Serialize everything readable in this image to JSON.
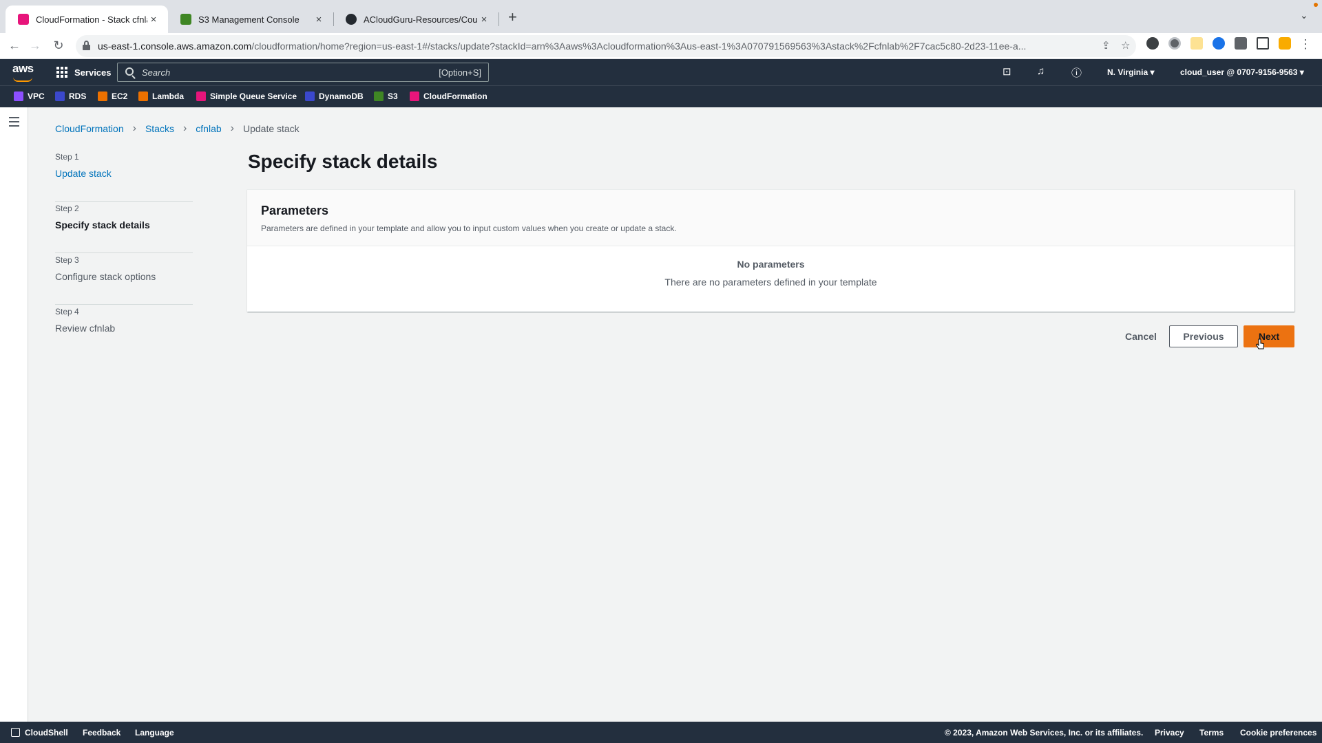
{
  "browser": {
    "tabs": [
      {
        "title": "CloudFormation - Stack cfnlab",
        "favicon_color": "#e7157b",
        "active": true
      },
      {
        "title": "S3 Management Console",
        "favicon_color": "#3f8624",
        "active": false
      },
      {
        "title": "ACloudGuru-Resources/Course",
        "favicon_color": "#24292f",
        "active": false
      }
    ],
    "close_glyph": "×",
    "new_tab_glyph": "+",
    "url_host": "us-east-1.console.aws.amazon.com",
    "url_path": "/cloudformation/home?region=us-east-1#/stacks/update?stackId=arn%3Aaws%3Acloudformation%3Aus-east-1%3A070791569563%3Astack%2Fcfnlab%2F7cac5c80-2d23-11ee-a..."
  },
  "aws": {
    "logo_text": "aws",
    "services_label": "Services",
    "search_placeholder": "Search",
    "search_shortcut": "[Option+S]",
    "region": "N. Virginia ▾",
    "account": "cloud_user @ 0707-9156-9563 ▾",
    "favorites": [
      {
        "label": "VPC",
        "color": "#8c4fff"
      },
      {
        "label": "RDS",
        "color": "#3b48cc"
      },
      {
        "label": "EC2",
        "color": "#ed7100"
      },
      {
        "label": "Lambda",
        "color": "#ed7100"
      },
      {
        "label": "Simple Queue Service",
        "color": "#e7157b"
      },
      {
        "label": "DynamoDB",
        "color": "#3b48cc"
      },
      {
        "label": "S3",
        "color": "#3f8624"
      },
      {
        "label": "CloudFormation",
        "color": "#e7157b"
      }
    ]
  },
  "breadcrumb": {
    "items": [
      "CloudFormation",
      "Stacks",
      "cfnlab"
    ],
    "current": "Update stack"
  },
  "steps": [
    {
      "number": "Step 1",
      "title": "Update stack"
    },
    {
      "number": "Step 2",
      "title": "Specify stack details"
    },
    {
      "number": "Step 3",
      "title": "Configure stack options"
    },
    {
      "number": "Step 4",
      "title": "Review cfnlab"
    }
  ],
  "main": {
    "page_title": "Specify stack details",
    "panel_title": "Parameters",
    "panel_description": "Parameters are defined in your template and allow you to input custom values when you create or update a stack.",
    "empty_title": "No parameters",
    "empty_description": "There are no parameters defined in your template"
  },
  "actions": {
    "cancel": "Cancel",
    "previous": "Previous",
    "next": "Next"
  },
  "footer": {
    "cloudshell": "CloudShell",
    "feedback": "Feedback",
    "language": "Language",
    "copyright": "© 2023, Amazon Web Services, Inc. or its affiliates.",
    "privacy": "Privacy",
    "terms": "Terms",
    "cookies": "Cookie preferences"
  }
}
